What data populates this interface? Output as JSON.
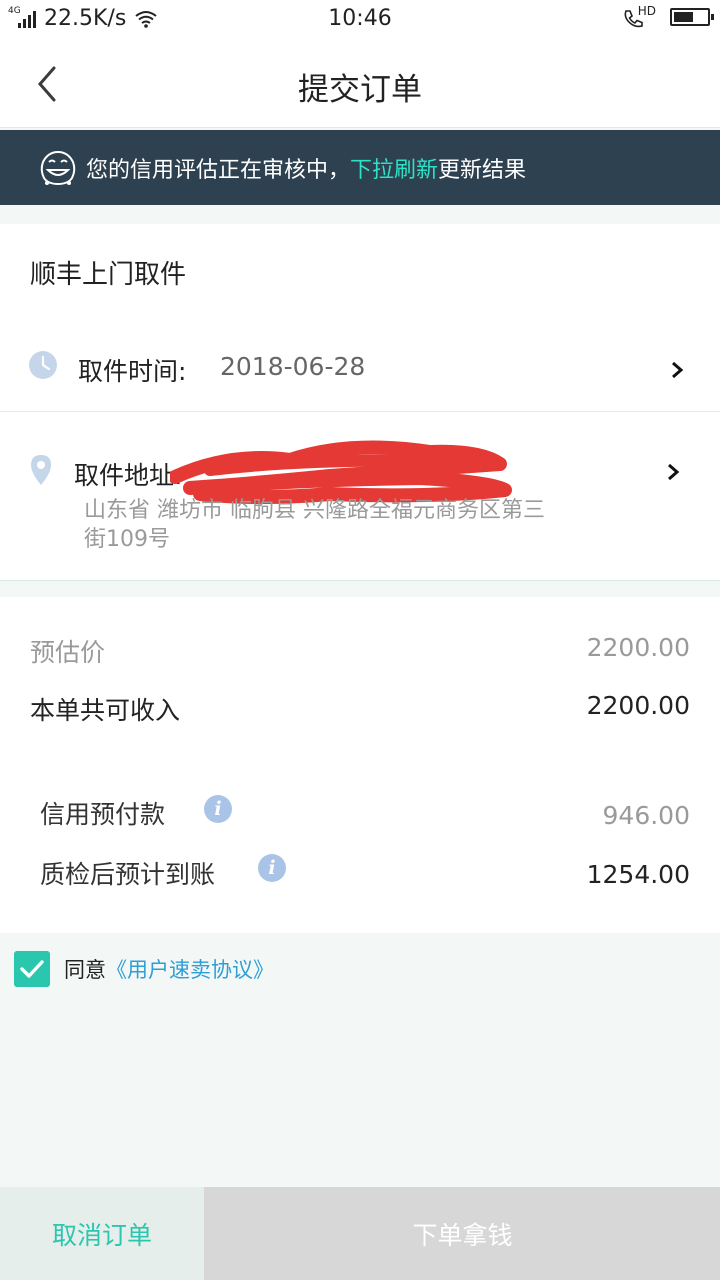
{
  "status_bar": {
    "network": "4G",
    "speed": "22.5K/s",
    "time": "10:46",
    "hd": "HD",
    "battery_level": 0.6
  },
  "nav": {
    "title": "提交订单",
    "back_icon": "chevron-left-icon"
  },
  "banner": {
    "text_before": "您的信用评估正在审核中，",
    "highlight": "下拉刷新",
    "text_after": "更新结果",
    "highlight_color": "#2ee0c6",
    "icon": "smiley-face-icon"
  },
  "pickup": {
    "title": "顺丰上门取件",
    "time_label": "取件时间:",
    "time_value": "2018-06-28",
    "address_label": "取件地址:",
    "address_text": "山东省 潍坊市 临朐县 兴隆路全福元商务区第三街109号"
  },
  "pricing": {
    "estimate_label": "预估价",
    "estimate_value": "2200.00",
    "total_label": "本单共可收入",
    "total_value": "2200.00",
    "credit_label": "信用预付款",
    "credit_value": "946.00",
    "after_label": "质检后预计到账",
    "after_value": "1254.00"
  },
  "agreement": {
    "checked": true,
    "text": "同意",
    "link": "《用户速卖协议》"
  },
  "actions": {
    "cancel": "取消订单",
    "submit": "下单拿钱"
  },
  "colors": {
    "accent": "#2ac6ad",
    "banner_bg": "#2e4150",
    "link": "#2e9ed6"
  }
}
